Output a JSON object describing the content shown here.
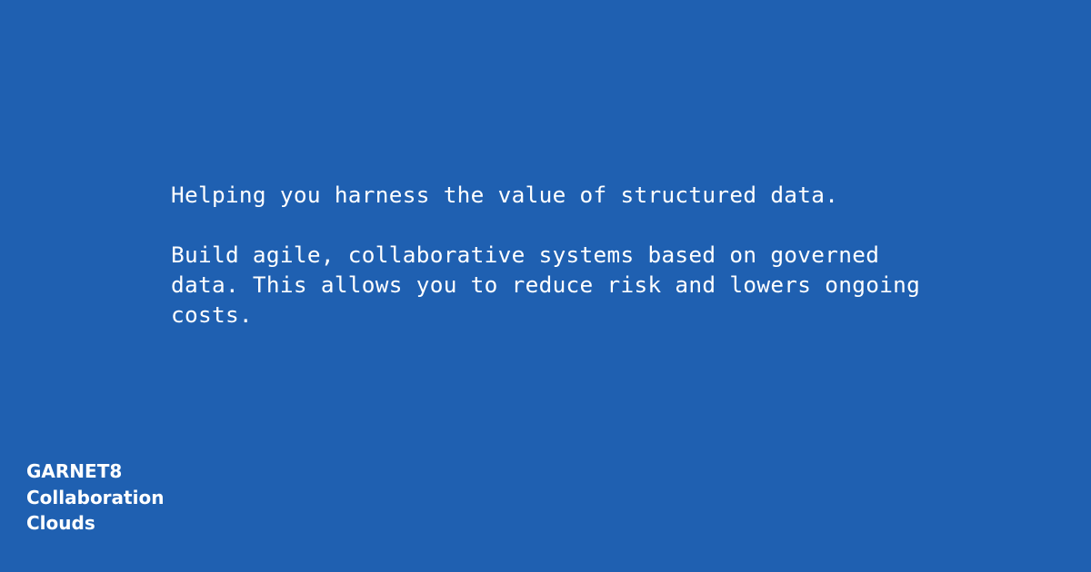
{
  "hero": {
    "headline": "Helping you harness the value of structured data.",
    "body_line_1": "Build agile, collaborative systems based on governed",
    "body_line_2": "data. This allows you to reduce risk and lowers ongoing",
    "body_line_3": "costs."
  },
  "brand": {
    "line_1": "GARNET8",
    "line_2": "Collaboration",
    "line_3": "Clouds"
  },
  "colors": {
    "background": "#1f60b1",
    "text": "#ffffff"
  }
}
